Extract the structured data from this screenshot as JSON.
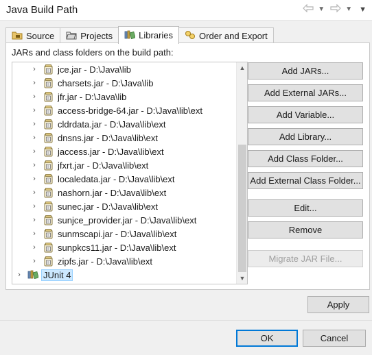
{
  "window": {
    "title": "Java Build Path"
  },
  "tabs": [
    {
      "label": "Source",
      "icon": "source-folder-icon",
      "active": false
    },
    {
      "label": "Projects",
      "icon": "projects-folder-icon",
      "active": false
    },
    {
      "label": "Libraries",
      "icon": "libraries-icon",
      "active": true
    },
    {
      "label": "Order and Export",
      "icon": "order-export-icon",
      "active": false
    }
  ],
  "libraries": {
    "label": "JARs and class folders on the build path:",
    "entries": [
      {
        "label": "jce.jar - D:\\Java\\lib"
      },
      {
        "label": "charsets.jar - D:\\Java\\lib"
      },
      {
        "label": "jfr.jar - D:\\Java\\lib"
      },
      {
        "label": "access-bridge-64.jar - D:\\Java\\lib\\ext"
      },
      {
        "label": "cldrdata.jar - D:\\Java\\lib\\ext"
      },
      {
        "label": "dnsns.jar - D:\\Java\\lib\\ext"
      },
      {
        "label": "jaccess.jar - D:\\Java\\lib\\ext"
      },
      {
        "label": "jfxrt.jar - D:\\Java\\lib\\ext"
      },
      {
        "label": "localedata.jar - D:\\Java\\lib\\ext"
      },
      {
        "label": "nashorn.jar - D:\\Java\\lib\\ext"
      },
      {
        "label": "sunec.jar - D:\\Java\\lib\\ext"
      },
      {
        "label": "sunjce_provider.jar - D:\\Java\\lib\\ext"
      },
      {
        "label": "sunmscapi.jar - D:\\Java\\lib\\ext"
      },
      {
        "label": "sunpkcs11.jar - D:\\Java\\lib\\ext"
      },
      {
        "label": "zipfs.jar - D:\\Java\\lib\\ext"
      }
    ],
    "junit": {
      "label": "JUnit 4",
      "selected": true
    }
  },
  "buttons": {
    "add_jars": "Add JARs...",
    "add_external_jars": "Add External JARs...",
    "add_variable": "Add Variable...",
    "add_library": "Add Library...",
    "add_class_folder": "Add Class Folder...",
    "add_external_class_folder": "Add External Class Folder...",
    "edit": "Edit...",
    "remove": "Remove",
    "migrate_jar": "Migrate JAR File...",
    "apply": "Apply",
    "ok": "OK",
    "cancel": "Cancel"
  },
  "colors": {
    "selection": "#cce8ff",
    "default_button_border": "#0078d7"
  }
}
